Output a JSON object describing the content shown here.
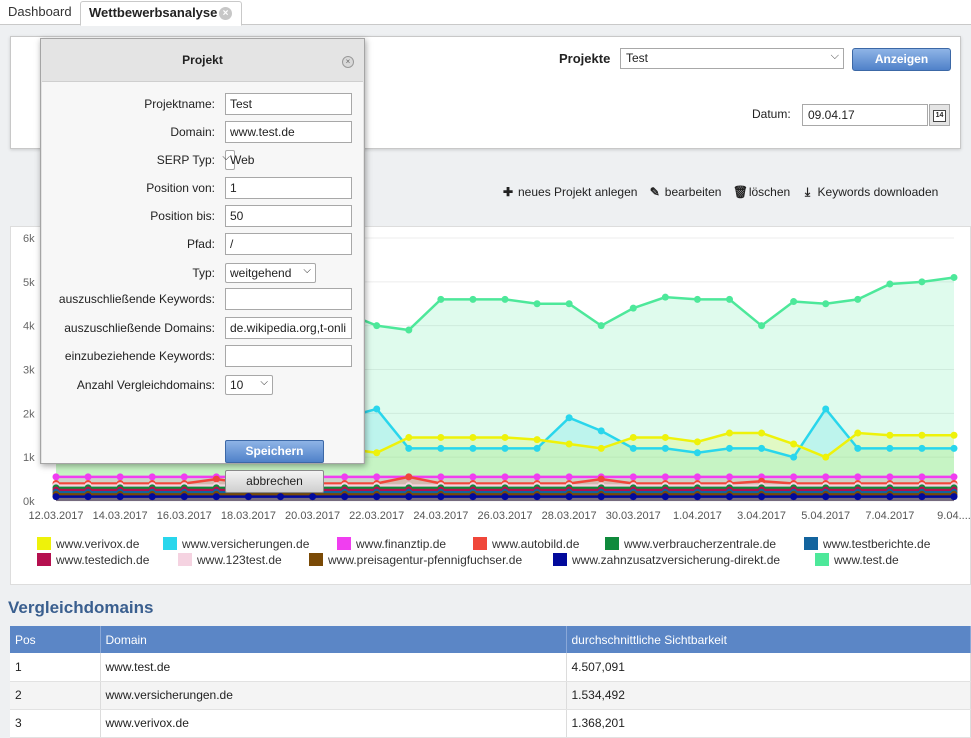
{
  "tabs": [
    {
      "label": "Dashboard"
    },
    {
      "label": "Wettbewerbsanalyse"
    }
  ],
  "controls": {
    "projekte_label": "Projekte",
    "projekte_value": "Test",
    "anzeigen_label": "Anzeigen",
    "datum_label": "Datum:",
    "datum_value": "09.04.17",
    "calendar_day": "14"
  },
  "actions": [
    {
      "icon": "plus-icon",
      "label": "neues Projekt anlegen"
    },
    {
      "icon": "pencil-icon",
      "label": "bearbeiten"
    },
    {
      "icon": "trash-icon",
      "label": "löschen"
    },
    {
      "icon": "download-icon",
      "label": "Keywords downloaden"
    }
  ],
  "dialog": {
    "title": "Projekt",
    "fields": [
      {
        "label": "Projektname:",
        "value": "Test",
        "type": "text"
      },
      {
        "label": "Domain:",
        "value": "www.test.de",
        "type": "text"
      },
      {
        "label": "SERP Typ:",
        "value": "Web",
        "type": "select"
      },
      {
        "label": "Position von:",
        "value": "1",
        "type": "text"
      },
      {
        "label": "Position bis:",
        "value": "50",
        "type": "text"
      },
      {
        "label": "Pfad:",
        "value": "/",
        "type": "text"
      },
      {
        "label": "Typ:",
        "value": "weitgehend",
        "type": "select"
      },
      {
        "label": "auszuschließende Keywords:",
        "value": "",
        "type": "text"
      },
      {
        "label": "auszuschließende Domains:",
        "value": "de.wikipedia.org,t-onli",
        "type": "text"
      },
      {
        "label": "einzubeziehende Keywords:",
        "value": "",
        "type": "text"
      },
      {
        "label": "Anzahl Vergleichdomains:",
        "value": "10",
        "type": "select"
      }
    ],
    "save_label": "Speichern",
    "cancel_label": "abbrechen"
  },
  "chart_data": {
    "type": "area",
    "ylim": [
      0,
      6000
    ],
    "yticks": [
      "0k",
      "1k",
      "2k",
      "3k",
      "4k",
      "5k",
      "6k"
    ],
    "x": [
      "12.03.2017",
      "13.03.2017",
      "14.03.2017",
      "15.03.2017",
      "16.03.2017",
      "17.03.2017",
      "18.03.2017",
      "19.03.2017",
      "20.03.2017",
      "21.03.2017",
      "22.03.2017",
      "23.03.2017",
      "24.03.2017",
      "25.03.2017",
      "26.03.2017",
      "27.03.2017",
      "28.03.2017",
      "29.03.2017",
      "30.03.2017",
      "31.03.2017",
      "1.04.2017",
      "2.04.2017",
      "3.04.2017",
      "4.04.2017",
      "5.04.2017",
      "6.04.2017",
      "7.04.2017",
      "8.04.2017",
      "9.04.2017"
    ],
    "xtick_labels": [
      "12.03.2017",
      "14.03.2017",
      "16.03.2017",
      "18.03.2017",
      "20.03.2017",
      "22.03.2017",
      "24.03.2017",
      "26.03.2017",
      "28.03.2017",
      "30.03.2017",
      "1.04.2017",
      "3.04.2017",
      "5.04.2017",
      "7.04.2017",
      "9.04...."
    ],
    "series": [
      {
        "name": "www.verivox.de",
        "color": "#eef20a",
        "values": [
          1400,
          1400,
          1400,
          1400,
          1400,
          1400,
          1400,
          1400,
          1400,
          1200,
          1100,
          1450,
          1450,
          1450,
          1450,
          1400,
          1300,
          1200,
          1450,
          1450,
          1350,
          1550,
          1550,
          1300,
          1000,
          1550,
          1500,
          1500,
          1500
        ]
      },
      {
        "name": "www.versicherungen.de",
        "color": "#29d6ec",
        "values": [
          1800,
          1800,
          1800,
          1800,
          1800,
          1800,
          1800,
          1800,
          1900,
          1900,
          2100,
          1200,
          1200,
          1200,
          1200,
          1200,
          1900,
          1600,
          1200,
          1200,
          1100,
          1200,
          1200,
          1000,
          2100,
          1200,
          1200,
          1200,
          1200
        ]
      },
      {
        "name": "www.finanztip.de",
        "color": "#f03ef0",
        "values": [
          550,
          550,
          550,
          550,
          550,
          550,
          550,
          550,
          550,
          550,
          550,
          550,
          550,
          550,
          550,
          550,
          550,
          550,
          550,
          550,
          550,
          550,
          550,
          550,
          550,
          550,
          550,
          550,
          550
        ]
      },
      {
        "name": "www.autobild.de",
        "color": "#f0473a",
        "values": [
          400,
          400,
          400,
          400,
          400,
          500,
          400,
          400,
          400,
          400,
          400,
          550,
          400,
          400,
          400,
          400,
          400,
          500,
          400,
          400,
          400,
          400,
          450,
          400,
          400,
          400,
          400,
          400,
          400
        ]
      },
      {
        "name": "www.verbraucherzentrale.de",
        "color": "#0f8a3c",
        "values": [
          300,
          300,
          300,
          300,
          300,
          300,
          300,
          300,
          300,
          300,
          300,
          300,
          300,
          300,
          300,
          300,
          300,
          300,
          300,
          300,
          300,
          300,
          300,
          300,
          300,
          300,
          300,
          300,
          300
        ]
      },
      {
        "name": "www.testberichte.de",
        "color": "#13649e",
        "values": [
          200,
          200,
          200,
          200,
          200,
          200,
          200,
          200,
          200,
          200,
          200,
          200,
          200,
          200,
          200,
          200,
          200,
          200,
          200,
          200,
          200,
          200,
          200,
          200,
          200,
          200,
          200,
          200,
          200
        ]
      },
      {
        "name": "www.testedich.de",
        "color": "#b5104f",
        "values": [
          250,
          250,
          250,
          250,
          250,
          250,
          250,
          250,
          250,
          250,
          250,
          250,
          250,
          250,
          250,
          250,
          250,
          250,
          250,
          250,
          250,
          250,
          250,
          250,
          250,
          250,
          250,
          250,
          250
        ]
      },
      {
        "name": "www.123test.de",
        "color": "#f5d3e1",
        "values": [
          350,
          350,
          350,
          350,
          350,
          350,
          350,
          350,
          350,
          350,
          350,
          350,
          350,
          350,
          350,
          350,
          350,
          350,
          350,
          350,
          350,
          350,
          350,
          350,
          350,
          350,
          350,
          350,
          350
        ]
      },
      {
        "name": "www.preisagentur-pfennigfuchser.de",
        "color": "#7a4a06",
        "values": [
          150,
          150,
          150,
          150,
          150,
          150,
          150,
          150,
          150,
          150,
          150,
          150,
          150,
          150,
          150,
          150,
          150,
          150,
          150,
          150,
          150,
          150,
          150,
          150,
          150,
          150,
          150,
          150,
          150
        ]
      },
      {
        "name": "www.zahnzusatzversicherung-direkt.de",
        "color": "#020a9c",
        "values": [
          100,
          100,
          100,
          100,
          100,
          100,
          100,
          100,
          100,
          100,
          100,
          100,
          100,
          100,
          100,
          100,
          100,
          100,
          100,
          100,
          100,
          100,
          100,
          100,
          100,
          100,
          100,
          100,
          100
        ]
      },
      {
        "name": "www.test.de",
        "color": "#4de89a",
        "values": [
          5500,
          5500,
          5500,
          5500,
          5500,
          5500,
          5500,
          5500,
          4200,
          4300,
          4000,
          3900,
          4600,
          4600,
          4600,
          4500,
          4500,
          4000,
          4400,
          4650,
          4600,
          4600,
          4000,
          4550,
          4500,
          4600,
          4950,
          5000,
          5100
        ]
      }
    ]
  },
  "vergleich": {
    "title": "Vergleichdomains",
    "headers": [
      "Pos",
      "Domain",
      "durchschnittliche Sichtbarkeit"
    ],
    "rows": [
      [
        "1",
        "www.test.de",
        "4.507,091"
      ],
      [
        "2",
        "www.versicherungen.de",
        "1.534,492"
      ],
      [
        "3",
        "www.verivox.de",
        "1.368,201"
      ]
    ]
  }
}
